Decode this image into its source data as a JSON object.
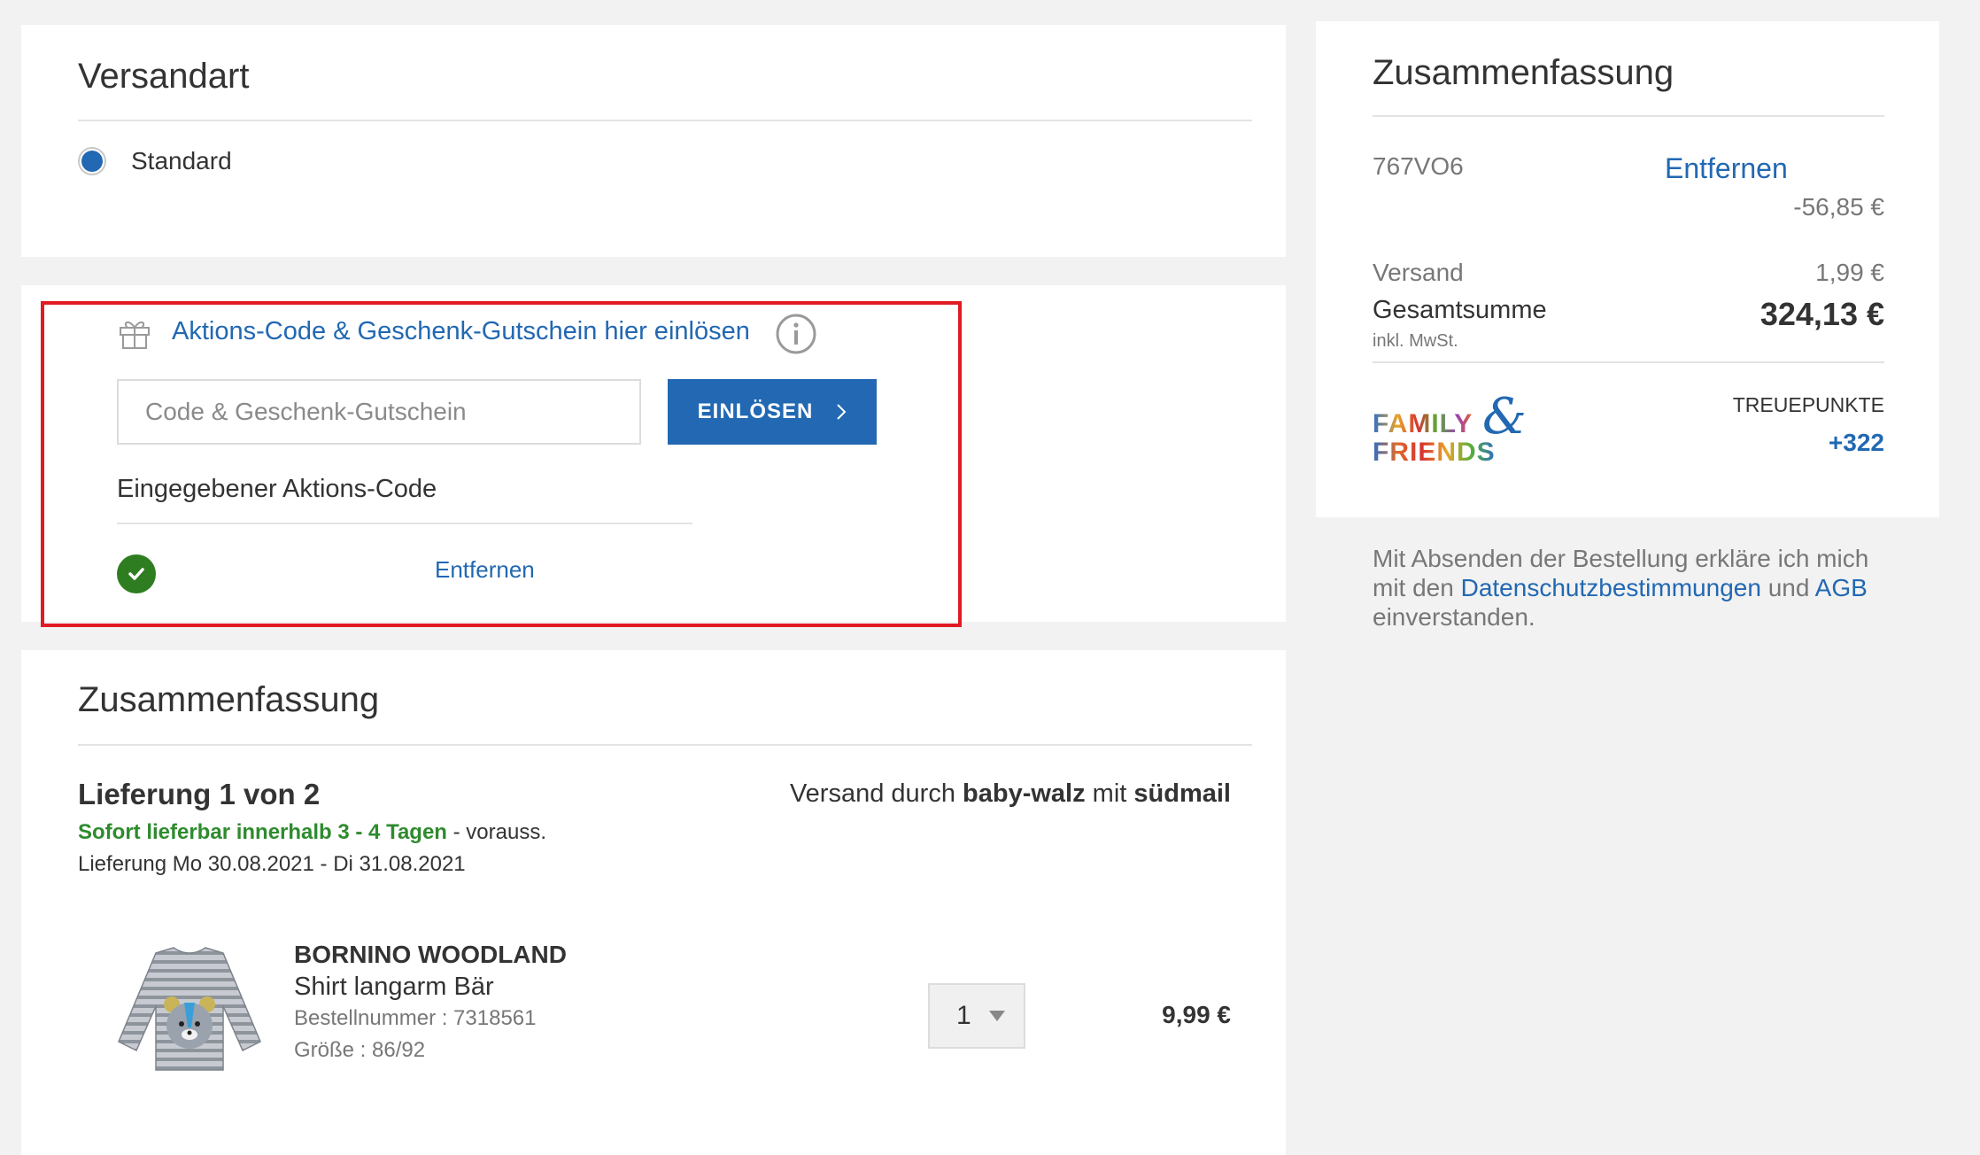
{
  "shipping": {
    "title": "Versandart",
    "option_label": "Standard"
  },
  "voucher": {
    "link_text": "Aktions-Code & Geschenk-Gutschein hier einlösen",
    "input_placeholder": "Code & Geschenk-Gutschein",
    "input_value": "",
    "redeem_button": "EINLÖSEN",
    "applied_heading": "Eingegebener Aktions-Code",
    "remove_link": "Entfernen"
  },
  "summary_main": {
    "title": "Zusammenfassung",
    "delivery_title": "Lieferung 1 von 2",
    "shipped_by_prefix": "Versand durch",
    "shipped_by_shop": "baby-walz",
    "shipped_by_mid": "mit",
    "shipped_by_carrier": "südmail",
    "availability_green": "Sofort lieferbar innerhalb 3 - 4 Tagen",
    "availability_rest": " - vorauss.",
    "delivery_dates": "Lieferung Mo 30.08.2021 - Di 31.08.2021",
    "item": {
      "brand": "BORNINO WOODLAND",
      "name": "Shirt langarm Bär",
      "order_number": "Bestellnummer : 7318561",
      "size": "Größe : 86/92",
      "quantity": "1",
      "price": "9,99 €"
    }
  },
  "sidebar": {
    "title": "Zusammenfassung",
    "coupon_code": "767VO6",
    "coupon_remove": "Entfernen",
    "coupon_discount": "-56,85 €",
    "shipping_label": "Versand",
    "shipping_value": "1,99 €",
    "total_label": "Gesamtsumme",
    "total_value": "324,13 €",
    "vat_note": "inkl. MwSt.",
    "loyalty_logo_line1": "FAMILY",
    "loyalty_logo_amp": "&",
    "loyalty_logo_line2": "FRIENDS",
    "loyalty_label": "TREUEPUNKTE",
    "loyalty_points": "+322",
    "legal_prefix": "Mit Absenden der Bestellung erkläre ich mich",
    "legal_mid_prefix": "mit den",
    "legal_privacy_link": "Datenschutzbestimmungen",
    "legal_and": "und",
    "legal_terms_link": "AGB",
    "legal_suffix": "einverstanden."
  },
  "colors": {
    "accent_blue": "#2268b2",
    "success_green": "#2e7d20",
    "highlight_red": "#e01b24",
    "background": "#f2f2f2"
  }
}
